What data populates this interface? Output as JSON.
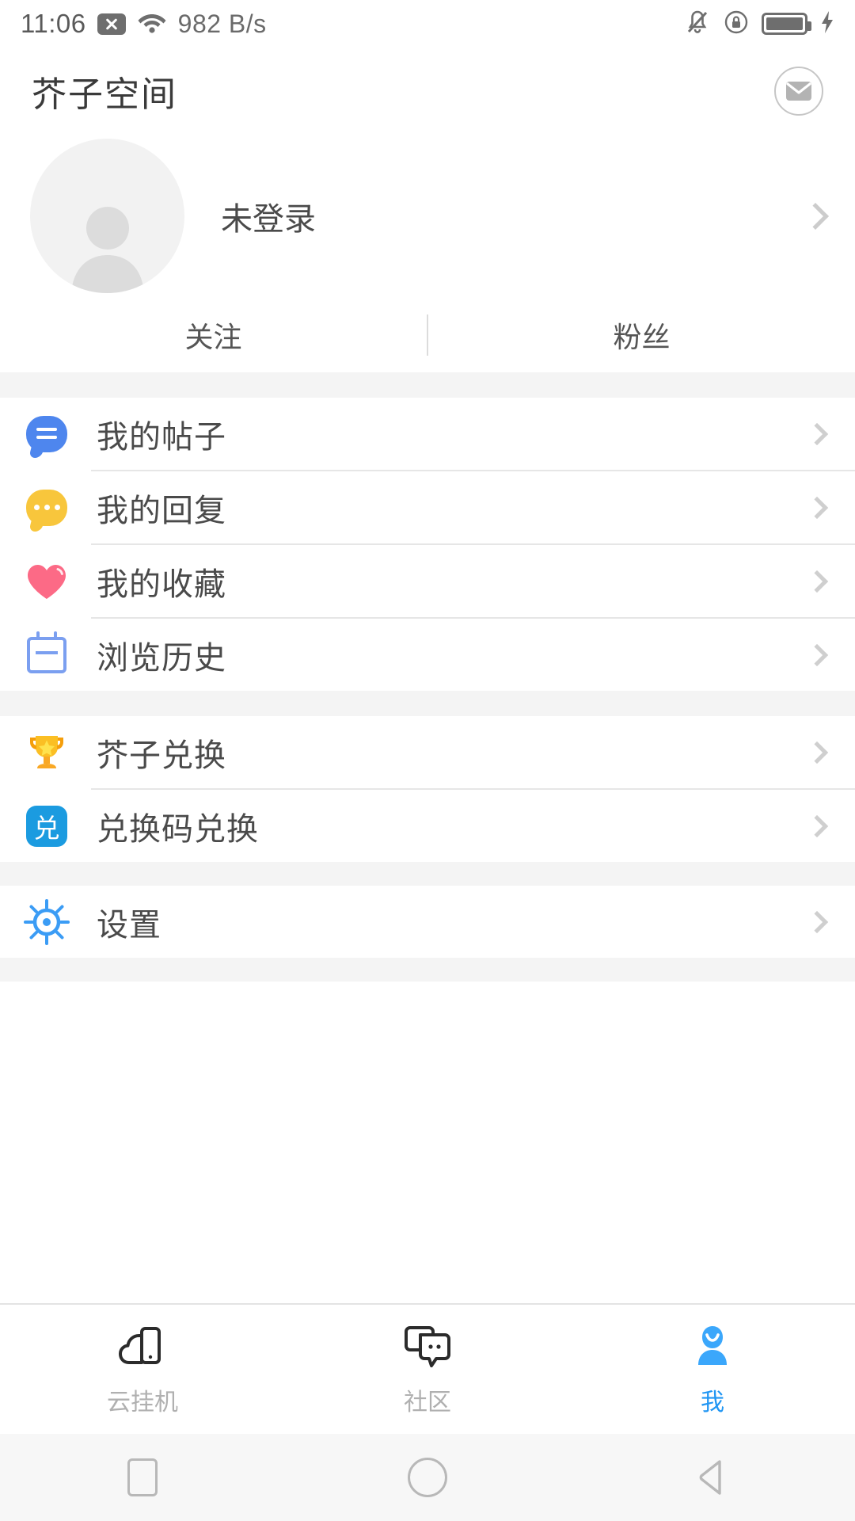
{
  "statusbar": {
    "time": "11:06",
    "network_speed": "982 B/s",
    "icons": [
      "x-message-icon",
      "wifi-icon",
      "bell-muted-icon",
      "rotation-lock-icon",
      "battery-charging-icon"
    ]
  },
  "header": {
    "title": "芥子空间",
    "mail_icon": "envelope-icon"
  },
  "profile": {
    "name": "未登录",
    "avatar_icon": "default-avatar-icon",
    "chevron": "chevron-right-icon"
  },
  "social": {
    "following_label": "关注",
    "fans_label": "粉丝"
  },
  "menu_groups": [
    {
      "items": [
        {
          "label": "我的帖子",
          "icon": "post-bubble-icon",
          "color": "#4e86ee"
        },
        {
          "label": "我的回复",
          "icon": "reply-bubble-icon",
          "color": "#f8c63c"
        },
        {
          "label": "我的收藏",
          "icon": "heart-icon",
          "color": "#fc6a86"
        },
        {
          "label": "浏览历史",
          "icon": "calendar-history-icon",
          "color": "#7b9ff0"
        }
      ]
    },
    {
      "items": [
        {
          "label": "芥子兑换",
          "icon": "trophy-icon",
          "color": "#f9b21d"
        },
        {
          "label": "兑换码兑换",
          "icon": "redeem-code-icon",
          "color": "#1b9be0",
          "glyph": "兑"
        }
      ]
    },
    {
      "items": [
        {
          "label": "设置",
          "icon": "settings-gear-icon",
          "color": "#3b9cf5"
        }
      ]
    }
  ],
  "tabbar": {
    "items": [
      {
        "label": "云挂机",
        "icon": "cloud-phone-icon",
        "active": false
      },
      {
        "label": "社区",
        "icon": "community-chat-icon",
        "active": false
      },
      {
        "label": "我",
        "icon": "person-icon",
        "active": true
      }
    ],
    "active_color": "#2196f3",
    "inactive_color": "#b0b0b0"
  },
  "navbar": {
    "recents": "recents-square-icon",
    "home": "home-circle-icon",
    "back": "back-triangle-icon"
  }
}
